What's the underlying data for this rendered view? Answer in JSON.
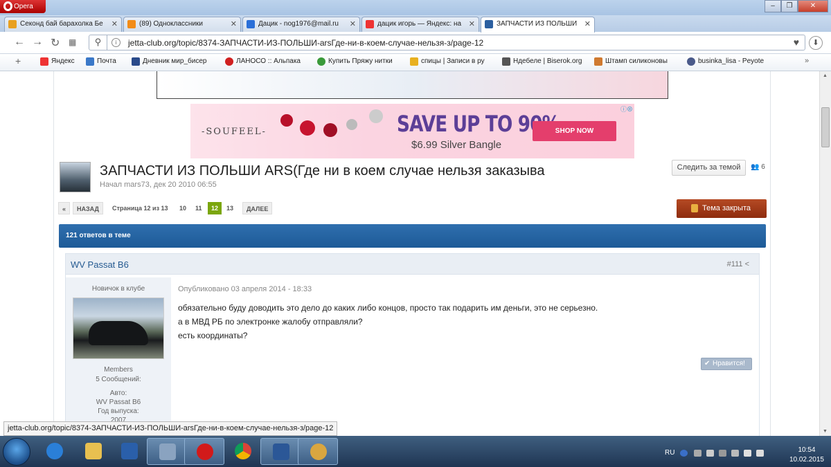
{
  "browser": {
    "menu_label": "Opera",
    "window_controls": [
      "–",
      "❐",
      "✕"
    ],
    "tabs": [
      {
        "label": "Секонд бай барахолка Бе",
        "color": "#e8a020"
      },
      {
        "label": "(89) Одноклассники",
        "color": "#f28c18"
      },
      {
        "label": "Дацик - nog1976@mail.ru",
        "color": "#2a6fd8"
      },
      {
        "label": "дацик игорь — Яндекс: на",
        "color": "#e33"
      },
      {
        "label": "ЗАПЧАСТИ ИЗ ПОЛЬШИ",
        "color": "#2b5fa0"
      }
    ],
    "url": "jetta-club.org/topic/8374-ЗАПЧАСТИ-ИЗ-ПОЛЬШИ-arsГде-ни-в-коем-случае-нельзя-з/page-12",
    "bookmarks": [
      {
        "label": "Яндекс",
        "color": "#e33"
      },
      {
        "label": "Почта",
        "color": "#3a78c8"
      },
      {
        "label": "Дневник мир_бисер",
        "color": "#2a4a8a"
      },
      {
        "label": "ЛАНОСО :: Альпака",
        "color": "#d02020"
      },
      {
        "label": "Купить Пряжу нитки",
        "color": "#3a9a3a"
      },
      {
        "label": "спицы | Записи в ру",
        "color": "#e8b020"
      },
      {
        "label": "Ндебеле | Biserok.org",
        "color": "#555"
      },
      {
        "label": "Штамп силиконовы",
        "color": "#d07a30"
      },
      {
        "label": "businka_lisa - Peyote",
        "color": "#4a5a8a"
      }
    ],
    "status_url": "jetta-club.org/topic/8374-ЗАПЧАСТИ-ИЗ-ПОЛЬШИ-arsГде-ни-в-коем-случае-нельзя-з/page-12"
  },
  "ad": {
    "brand": "-SOUFEEL-",
    "headline": "SAVE UP TO 90%",
    "subline": "$6.99 Silver Bangle",
    "cta": "SHOP NOW"
  },
  "topic": {
    "title": "ЗАПЧАСТИ ИЗ ПОЛЬШИ ARS(Где ни в коем случае нельзя заказыва",
    "started": "Начал mars73, дек 20 2010 06:55",
    "follow_label": "Следить за темой",
    "follow_count": "6",
    "closed_label": "Тема закрыта",
    "replies": "121 ответов в теме"
  },
  "pager": {
    "prev_symbol": "«",
    "back": "НАЗАД",
    "info": "Страница 12 из 13",
    "pages": [
      "10",
      "11",
      "12",
      "13"
    ],
    "current": "12",
    "next": "ДАЛЕЕ"
  },
  "post": {
    "author": "WV Passat B6",
    "number": "#111",
    "rank": "Новичок в клубе",
    "group": "Members",
    "posts": "5 Сообщений:",
    "auto_label": "Авто:",
    "auto": "WV Passat B6",
    "year_label": "Год выпуска:",
    "year": "2007",
    "published": "Опубликовано 03 апреля 2014 - 18:33",
    "lines": [
      "обязательно буду доводить это дело до каких либо концов, просто так подарить им деньги, это не серьезно.",
      "а в МВД РБ по электронке жалобу отправляли?",
      "есть координаты?"
    ],
    "like_label": "Нравится!"
  },
  "taskbar": {
    "language": "RU",
    "time": "10:54",
    "date": "10.02.2015"
  }
}
